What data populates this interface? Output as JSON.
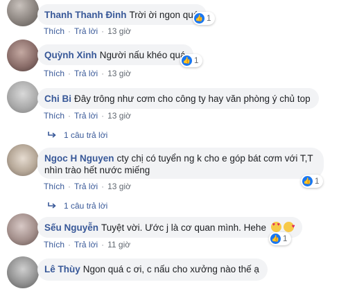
{
  "comments": [
    {
      "name": "Thanh Thanh Đinh",
      "text": "Trời ời ngon quá",
      "like_count": "1",
      "time": "13 giờ"
    },
    {
      "name": "Quỳnh Xinh",
      "text": "Người nấu khéo quá",
      "like_count": "1",
      "time": "13 giờ"
    },
    {
      "name": "Chi Bi",
      "text": "Đây trông như cơm cho công ty hay văn phòng ý chủ top",
      "time": "13 giờ",
      "replies": "1 câu trả lời"
    },
    {
      "name": "Ngoc H Nguyen",
      "text_line1": "cty chị có tuyển ng k cho e góp bát cơm với T,T",
      "text_line2": "nhìn trào hết nước miếng",
      "like_count": "1",
      "time": "13 giờ",
      "replies": "1 câu trả lời"
    },
    {
      "name": "Sếu Nguyễn",
      "text": "Tuyệt vời. Ước j là cơ quan mình. Hehe",
      "like_count": "1",
      "time": "11 giờ"
    },
    {
      "name": "Lê Thùy",
      "text": "Ngon quá c ơi, c nấu cho xưởng nào thế ạ"
    }
  ],
  "labels": {
    "like": "Thích",
    "reply": "Trả lời",
    "dot": "·"
  },
  "colors": {
    "name": "#385898",
    "bubble": "#f2f3f5",
    "like": "#1877f2"
  }
}
